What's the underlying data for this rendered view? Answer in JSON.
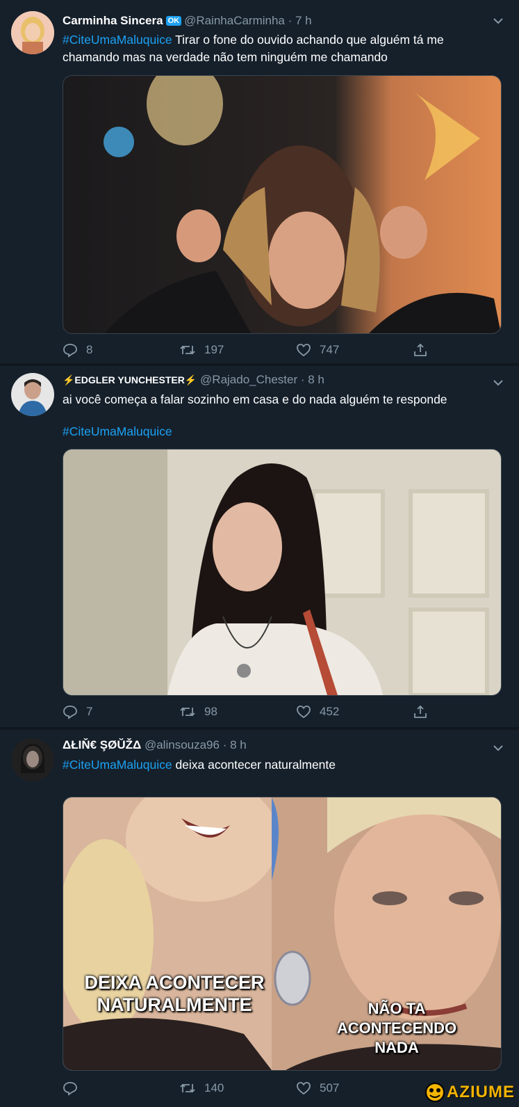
{
  "tweets": [
    {
      "name": "Carminha Sincera",
      "verified_badge": "OK",
      "handle": "@RainhaCarminha",
      "time": "· 7 h",
      "hashtag": "#CiteUmaMaluquice",
      "text_after": " Tirar o fone do ouvido achando que alguém tá me chamando mas na verdade não tem ninguém me chamando",
      "replies": "8",
      "retweets": "197",
      "likes": "747"
    },
    {
      "name": "⚡EDGLER YUNCHESTER⚡",
      "handle": "@Rajado_Chester",
      "time": "· 8 h",
      "text": "ai você começa a falar sozinho em casa e do nada alguém te responde",
      "hashtag": "#CiteUmaMaluquice",
      "replies": "7",
      "retweets": "98",
      "likes": "452"
    },
    {
      "name": "ΔŁIŇ€ ŞØŬŽΔ",
      "handle": "@alinsouza96",
      "time": "· 8 h",
      "hashtag": "#CiteUmaMaluquice",
      "text_after": " deixa acontecer naturalmente",
      "replies": "",
      "retweets": "140",
      "likes": "507",
      "caption_left": "DEIXA ACONTECER NATURALMENTE",
      "caption_right": "NÃO TA ACONTECENDO NADA"
    }
  ],
  "watermark": "AZIUME",
  "colors": {
    "background": "#15202b",
    "accent": "#1da1f2",
    "muted": "#8899a6",
    "separator": "#10171e"
  },
  "icons": [
    "reply-icon",
    "retweet-icon",
    "like-icon",
    "share-icon",
    "chevron-down-icon",
    "verified-badge"
  ]
}
